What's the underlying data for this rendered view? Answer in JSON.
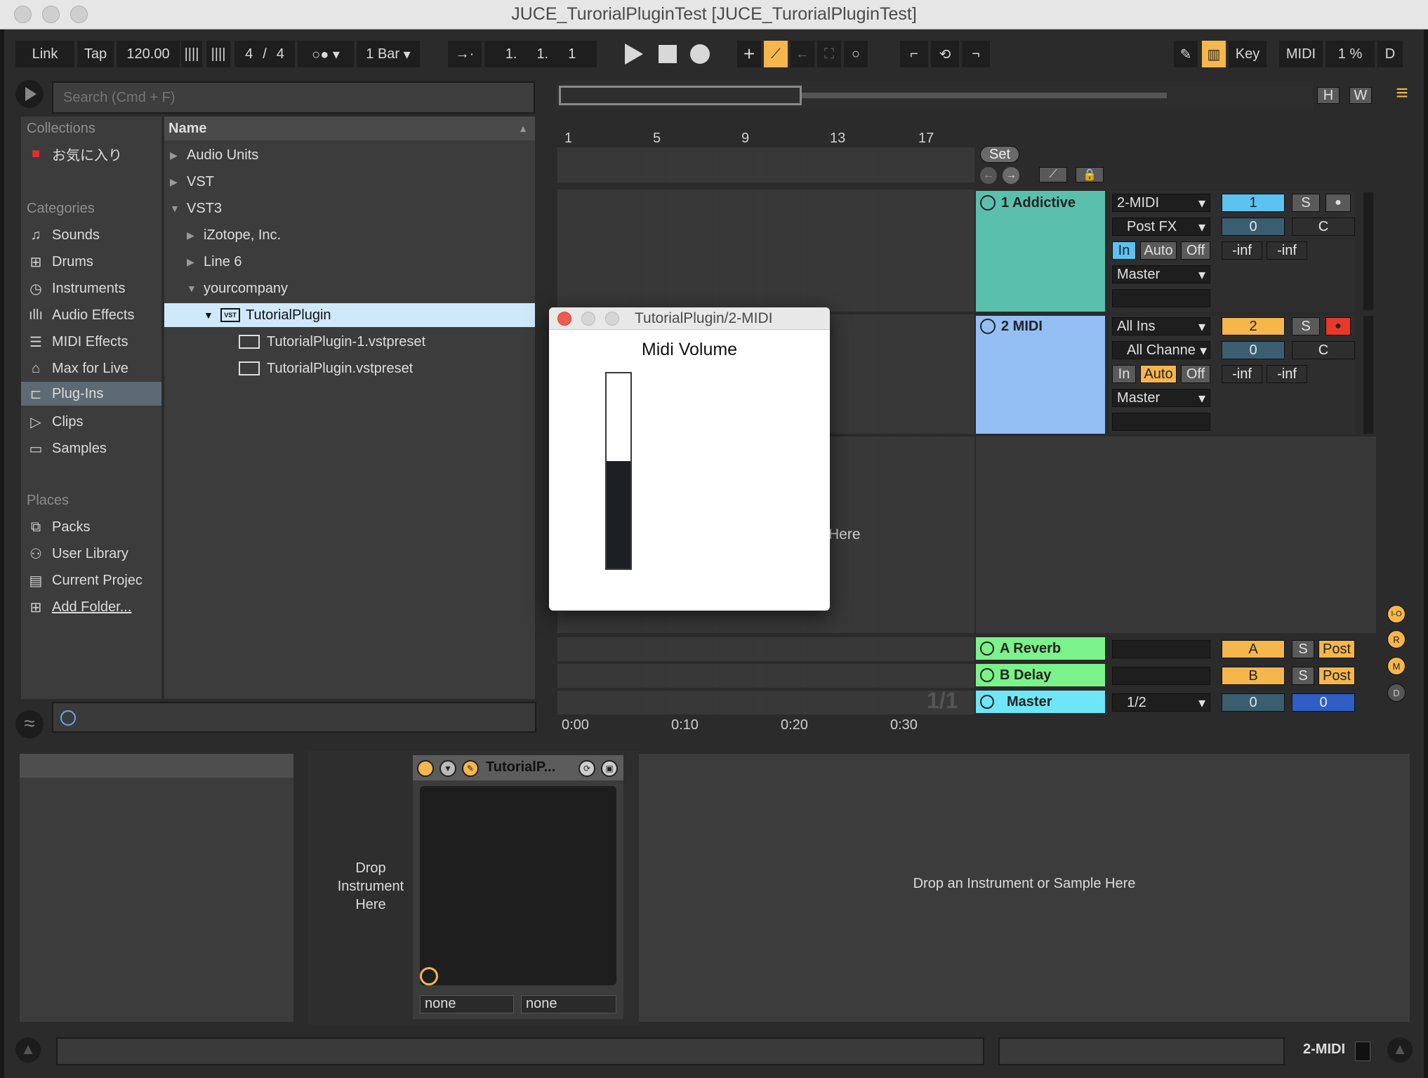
{
  "window": {
    "title": "JUCE_TurorialPluginTest  [JUCE_TurorialPluginTest]"
  },
  "transport": {
    "link": "Link",
    "tap": "Tap",
    "tempo": "120.00",
    "time_sig_num": "4",
    "time_sig_sep": "/",
    "time_sig_den": "4",
    "quantize": "1 Bar",
    "position": [
      "1.",
      "1.",
      "1"
    ],
    "key": "Key",
    "midi": "MIDI",
    "cpu": "1 %",
    "d": "D"
  },
  "browser": {
    "search_placeholder": "Search (Cmd + F)",
    "collections_header": "Collections",
    "favorite": "お気に入り",
    "categories_header": "Categories",
    "categories": [
      "Sounds",
      "Drums",
      "Instruments",
      "Audio Effects",
      "MIDI Effects",
      "Max for Live",
      "Plug-Ins",
      "Clips",
      "Samples"
    ],
    "selected_category": "Plug-Ins",
    "places_header": "Places",
    "places": [
      "Packs",
      "User Library",
      "Current Projec",
      "Add Folder..."
    ],
    "name_header": "Name",
    "tree": [
      "Audio Units",
      "VST",
      "VST3",
      "iZotope, Inc.",
      "Line 6",
      "yourcompany",
      "TutorialPlugin",
      "TutorialPlugin-1.vstpreset",
      "TutorialPlugin.vstpreset"
    ]
  },
  "arrangement": {
    "ruler": [
      "1",
      "5",
      "9",
      "13",
      "17"
    ],
    "time": [
      "0:00",
      "0:10",
      "0:20",
      "0:30"
    ],
    "set": "Set",
    "drop_here": "Here",
    "page": "1/1",
    "h": "H",
    "w": "W"
  },
  "tracks": [
    {
      "name": "1 Addictive",
      "color": "#5bbfae",
      "input": "2-MIDI",
      "input2": "Post FX",
      "in": "In",
      "auto": "Auto",
      "off": "Off",
      "out": "Master",
      "num": "1",
      "s": "S",
      "vol": "0",
      "pan": "C",
      "db1": "-inf",
      "db2": "-inf"
    },
    {
      "name": "2 MIDI",
      "color": "#93bff5",
      "input": "All Ins",
      "input2": "All Channe",
      "in": "In",
      "auto": "Auto",
      "off": "Off",
      "out": "Master",
      "num": "2",
      "s": "S",
      "vol": "0",
      "pan": "C",
      "db1": "-inf",
      "db2": "-inf"
    }
  ],
  "returns": [
    {
      "name": "A Reverb",
      "letter": "A",
      "s": "S",
      "post": "Post"
    },
    {
      "name": "B Delay",
      "letter": "B",
      "s": "S",
      "post": "Post"
    }
  ],
  "master": {
    "name": "Master",
    "ratio": "1/2",
    "vol": "0",
    "pan": "0"
  },
  "io_buttons": [
    "I-O",
    "R",
    "M",
    "D"
  ],
  "plugin_window": {
    "title": "TutorialPlugin/2-MIDI",
    "heading": "Midi Volume",
    "level": 0.55
  },
  "device": {
    "drop_instrument": "Drop Instrument Here",
    "plugin_name": "TutorialP...",
    "param1": "none",
    "param2": "none",
    "drop_sample": "Drop an Instrument or Sample Here"
  },
  "status": {
    "track": "2-MIDI"
  }
}
